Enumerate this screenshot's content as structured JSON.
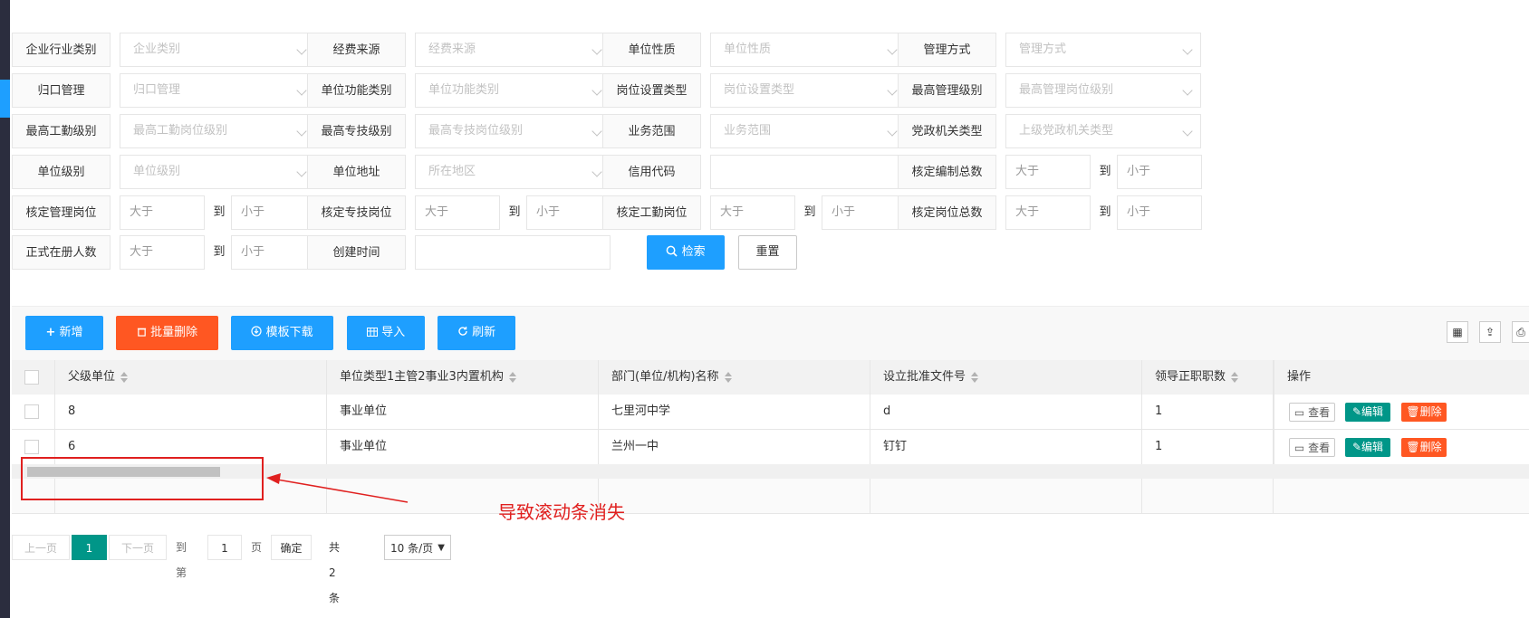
{
  "filters": {
    "row1": [
      {
        "label": "企业行业类别",
        "placeholder": "企业类别"
      },
      {
        "label": "经费来源",
        "placeholder": "经费来源"
      },
      {
        "label": "单位性质",
        "placeholder": "单位性质"
      },
      {
        "label": "管理方式",
        "placeholder": "管理方式"
      }
    ],
    "row2": [
      {
        "label": "归口管理",
        "placeholder": "归口管理"
      },
      {
        "label": "单位功能类别",
        "placeholder": "单位功能类别"
      },
      {
        "label": "岗位设置类型",
        "placeholder": "岗位设置类型"
      },
      {
        "label": "最高管理级别",
        "placeholder": "最高管理岗位级别"
      }
    ],
    "row3": [
      {
        "label": "最高工勤级别",
        "placeholder": "最高工勤岗位级别"
      },
      {
        "label": "最高专技级别",
        "placeholder": "最高专技岗位级别"
      },
      {
        "label": "业务范围",
        "placeholder": "业务范围"
      },
      {
        "label": "党政机关类型",
        "placeholder": "上级党政机关类型"
      }
    ],
    "row4": {
      "unit_level": {
        "label": "单位级别",
        "placeholder": "单位级别"
      },
      "address": {
        "label": "单位地址",
        "placeholder": "所在地区"
      },
      "credit": {
        "label": "信用代码"
      },
      "total_staff": {
        "label": "核定编制总数",
        "from": "大于",
        "to": "到",
        "until": "小于"
      }
    },
    "row5": [
      {
        "label": "核定管理岗位",
        "from": "大于",
        "to": "到",
        "until": "小于"
      },
      {
        "label": "核定专技岗位",
        "from": "大于",
        "to": "到",
        "until": "小于"
      },
      {
        "label": "核定工勤岗位",
        "from": "大于",
        "to": "到",
        "until": "小于"
      },
      {
        "label": "核定岗位总数",
        "from": "大于",
        "to": "到",
        "until": "小于"
      }
    ],
    "row6": {
      "registered": {
        "label": "正式在册人数",
        "from": "大于",
        "to": "到",
        "until": "小于"
      },
      "created": {
        "label": "创建时间"
      }
    },
    "search_label": "检索",
    "reset_label": "重置"
  },
  "toolbar": {
    "add": "新增",
    "batch_delete": "批量删除",
    "template": "模板下载",
    "import": "导入",
    "refresh": "刷新"
  },
  "table": {
    "columns": [
      "父级单位",
      "单位类型1主管2事业3内置机构",
      "部门(单位/机构)名称",
      "设立批准文件号",
      "领导正职职数",
      "操作"
    ],
    "rows": [
      {
        "parent": "8",
        "type": "事业单位",
        "name": "七里河中学",
        "doc": "d",
        "leaders": "1"
      },
      {
        "parent": "6",
        "type": "事业单位",
        "name": "兰州一中",
        "doc": "钉钉",
        "leaders": "1"
      }
    ],
    "actions": {
      "view": "查看",
      "edit": "编辑",
      "delete": "删除"
    }
  },
  "annotation": "导致滚动条消失",
  "pager": {
    "prev": "上一页",
    "current": "1",
    "next": "下一页",
    "goto": "到第",
    "page_value": "1",
    "page_unit": "页",
    "confirm": "确定",
    "total": "共 2 条",
    "page_size": "10 条/页"
  },
  "colors": {
    "primary": "#1e9fff",
    "danger": "#ff5722",
    "teal": "#009688",
    "annotation": "#e0201f"
  }
}
